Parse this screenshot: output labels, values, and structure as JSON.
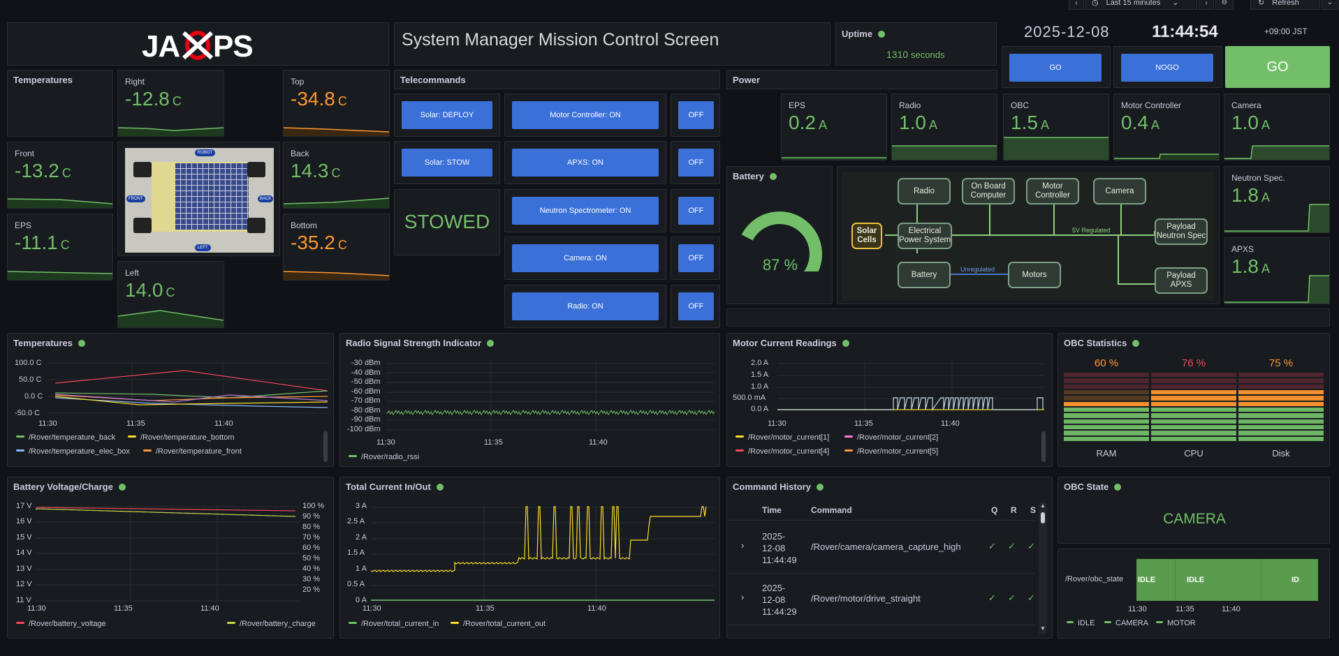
{
  "topbar": {
    "time_range": "Last 15 minutes",
    "refresh": "Refresh"
  },
  "logo": {
    "text": "JAXPS"
  },
  "header": {
    "title": "System Manager Mission Control Screen"
  },
  "uptime": {
    "title": "Uptime",
    "value": "1310",
    "unit": "seconds"
  },
  "clock": {
    "date": "2025-12-08",
    "time": "11:44:54",
    "tz": "+09:00 JST"
  },
  "gonogo": {
    "go_btn": "GO",
    "nogo_btn": "NOGO",
    "status": "GO",
    "status_color": "#73bf69"
  },
  "temperatures": {
    "title": "Temperatures",
    "right": {
      "label": "Right",
      "value": "-12.8",
      "unit": "C"
    },
    "top": {
      "label": "Top",
      "value": "-34.8",
      "unit": "C"
    },
    "front": {
      "label": "Front",
      "value": "-13.2",
      "unit": "C"
    },
    "back": {
      "label": "Back",
      "value": "14.3",
      "unit": "C"
    },
    "eps": {
      "label": "EPS",
      "value": "-11.1",
      "unit": "C"
    },
    "bottom": {
      "label": "Bottom",
      "value": "-35.2",
      "unit": "C"
    },
    "left": {
      "label": "Left",
      "value": "14.0",
      "unit": "C"
    }
  },
  "rover_image": {
    "labels": [
      "ROBOT",
      "FRONT",
      "BACK",
      "LEFT"
    ]
  },
  "telecommands": {
    "title": "Telecommands",
    "solar_deploy": "Solar: DEPLOY",
    "solar_stow": "Solar: STOW",
    "solar_state": "STOWED",
    "rows": [
      {
        "on": "Motor Controller: ON",
        "off": "OFF"
      },
      {
        "on": "APXS: ON",
        "off": "OFF"
      },
      {
        "on": "Neutron Spectrometer: ON",
        "off": "OFF"
      },
      {
        "on": "Camera: ON",
        "off": "OFF"
      },
      {
        "on": "Radio: ON",
        "off": "OFF"
      }
    ]
  },
  "power": {
    "title": "Power",
    "eps": {
      "label": "EPS",
      "value": "0.2",
      "unit": "A"
    },
    "radio": {
      "label": "Radio",
      "value": "1.0",
      "unit": "A"
    },
    "obc": {
      "label": "OBC",
      "value": "1.5",
      "unit": "A"
    },
    "motor": {
      "label": "Motor Controller",
      "value": "0.4",
      "unit": "A"
    },
    "camera": {
      "label": "Camera",
      "value": "1.0",
      "unit": "A"
    },
    "neutron": {
      "label": "Neutron Spec.",
      "value": "1.8",
      "unit": "A"
    },
    "apxs": {
      "label": "APXS",
      "value": "1.8",
      "unit": "A"
    }
  },
  "battery": {
    "title": "Battery",
    "value": "87",
    "unit": "%",
    "percent": 87
  },
  "diagram": {
    "solar": "Solar\nCells",
    "eps": "Electrical\nPower System",
    "radio": "Radio",
    "obc": "On Board\nComputer",
    "motorctrl": "Motor\nController",
    "camera": "Camera",
    "battery": "Battery",
    "motors": "Motors",
    "neutron": "Payload\nNeutron Spec",
    "apxs": "Payload\nAPXS",
    "regulated": "5V Regulated",
    "unregulated": "Unregulated"
  },
  "charts": {
    "temps": {
      "title": "Temperatures",
      "yticks": [
        "100.0 C",
        "50.0 C",
        "0.0 C",
        "-50.0 C"
      ],
      "xticks": [
        "11:30",
        "11:35",
        "11:40"
      ],
      "legend": [
        {
          "name": "/Rover/temperature_back",
          "color": "#73bf69"
        },
        {
          "name": "/Rover/temperature_bottom",
          "color": "#fade2a"
        },
        {
          "name": "/Rover/temperature_elec_box",
          "color": "#8ab8ff"
        },
        {
          "name": "/Rover/temperature_front",
          "color": "#ff9830"
        }
      ]
    },
    "rssi": {
      "title": "Radio Signal Strength Indicator",
      "yticks": [
        "-30 dBm",
        "-40 dBm",
        "-50 dBm",
        "-60 dBm",
        "-70 dBm",
        "-80 dBm",
        "-90 dBm",
        "-100 dBm"
      ],
      "xticks": [
        "11:30",
        "11:35",
        "11:40"
      ],
      "legend": [
        {
          "name": "/Rover/radio_rssi",
          "color": "#73bf69"
        }
      ]
    },
    "motor": {
      "title": "Motor Current Readings",
      "yticks": [
        "2.0 A",
        "1.5 A",
        "1.0 A",
        "500.0 mA",
        "0.0 A"
      ],
      "xticks": [
        "11:30",
        "11:35",
        "11:40"
      ],
      "legend": [
        {
          "name": "/Rover/motor_current[1]",
          "color": "#fade2a"
        },
        {
          "name": "/Rover/motor_current[2]",
          "color": "#ff7ad9"
        },
        {
          "name": "/Rover/motor_current[4]",
          "color": "#f2495c"
        },
        {
          "name": "/Rover/motor_current[5]",
          "color": "#ff9830"
        }
      ]
    },
    "obcstats": {
      "title": "OBC Statistics",
      "items": [
        {
          "label": "RAM",
          "value": "60 %",
          "color": "#ff9830",
          "pct": 60
        },
        {
          "label": "CPU",
          "value": "76 %",
          "color": "#f2495c",
          "pct": 76
        },
        {
          "label": "Disk",
          "value": "75 %",
          "color": "#ff9830",
          "pct": 75
        }
      ]
    },
    "battery": {
      "title": "Battery Voltage/Charge",
      "yticks": [
        "17 V",
        "16 V",
        "15 V",
        "14 V",
        "13 V",
        "12 V",
        "11 V"
      ],
      "y2ticks": [
        "100 %",
        "90 %",
        "80 %",
        "70 %",
        "60 %",
        "50 %",
        "40 %",
        "30 %",
        "20 %"
      ],
      "xticks": [
        "11:30",
        "11:35",
        "11:40"
      ],
      "legend": [
        {
          "name": "/Rover/battery_voltage",
          "color": "#f2495c"
        },
        {
          "name": "/Rover/battery_charge",
          "color": "#c8d94f"
        }
      ]
    },
    "current": {
      "title": "Total Current In/Out",
      "yticks": [
        "3 A",
        "2.5 A",
        "2 A",
        "1.5 A",
        "1 A",
        "0.5 A",
        "0 A"
      ],
      "xticks": [
        "11:30",
        "11:35",
        "11:40"
      ],
      "legend": [
        {
          "name": "/Rover/total_current_in",
          "color": "#73bf69"
        },
        {
          "name": "/Rover/total_current_out",
          "color": "#fade2a"
        }
      ]
    }
  },
  "command_history": {
    "title": "Command History",
    "headers": {
      "time": "Time",
      "command": "Command",
      "q": "Q",
      "r": "R",
      "s": "S"
    },
    "rows": [
      {
        "time": [
          "2025-",
          "12-08",
          "11:44:49"
        ],
        "command": "/Rover/camera/camera_capture_high"
      },
      {
        "time": [
          "2025-",
          "12-08",
          "11:44:29"
        ],
        "command": "/Rover/motor/drive_straight"
      }
    ]
  },
  "obc_state": {
    "title": "OBC State",
    "value": "CAMERA",
    "series_label": "/Rover/obc_state",
    "segments": [
      "IDLE",
      "IDLE",
      "ID"
    ],
    "xticks": [
      "11:30",
      "11:35",
      "11:40"
    ],
    "legend": [
      {
        "name": "IDLE",
        "color": "#73bf69"
      },
      {
        "name": "CAMERA",
        "color": "#73bf69"
      },
      {
        "name": "MOTOR",
        "color": "#73bf69"
      }
    ]
  }
}
